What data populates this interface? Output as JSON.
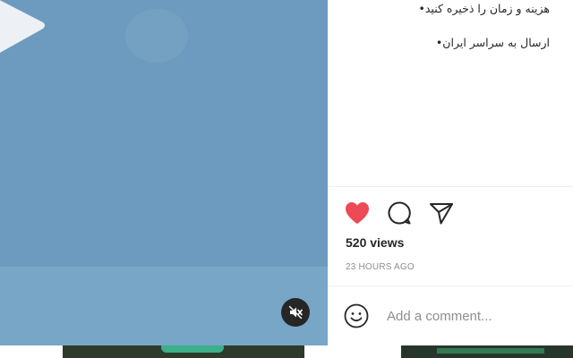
{
  "caption": {
    "lines": [
      "هزینه و زمان را ذخیره کنید•",
      "ارسال به سراسر ایران•"
    ]
  },
  "actions": {
    "like_icon": "heart-filled-icon",
    "comment_icon": "comment-bubble-icon",
    "share_icon": "paper-plane-icon",
    "like_color": "#ed4956"
  },
  "stats": {
    "views": "520 views",
    "timestamp": "23 HOURS AGO"
  },
  "comment": {
    "placeholder": "Add a comment...",
    "emoji_icon": "smiley-icon"
  },
  "media": {
    "mute_icon": "speaker-muted-icon",
    "background_color": "#6c9bbf"
  }
}
